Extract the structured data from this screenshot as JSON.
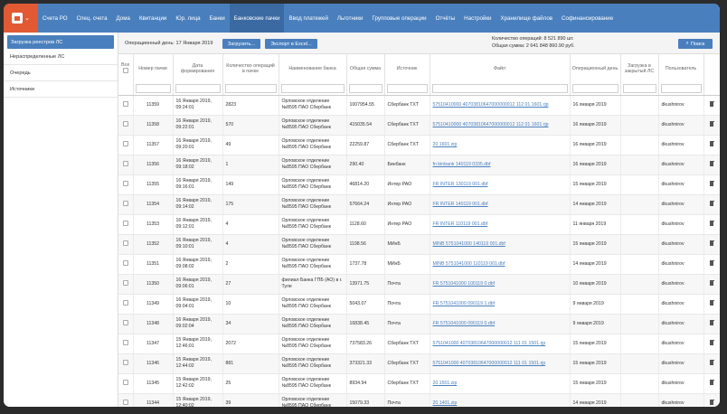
{
  "nav": {
    "items": [
      "Счета РО",
      "Спец. счета",
      "Дома",
      "Квитанции",
      "Юр. лица",
      "Банки",
      "Банковские пачки",
      "Ввод платежей",
      "Льготники",
      "Групповые операции",
      "Отчёты",
      "Настройки",
      "Хранилище файлов",
      "Софинансирование"
    ],
    "active_index": 6
  },
  "sidebar": {
    "items": [
      "Загрузка реестров ЛС",
      "Нераспределенные ЛС",
      "Очередь",
      "Источники"
    ],
    "active_index": 0
  },
  "toolbar": {
    "op_day": "Операционный день: 17 Января 2019",
    "load_label": "Загрузить...",
    "export_label": "Экспорт в Excel...",
    "op_count": "Количество операций: 8 521 890 шт.",
    "op_sum": "Общая сумма: 2 641 848 860.90 руб.",
    "search_label": "Поиск"
  },
  "table": {
    "headers": [
      "Все",
      "Номер пачки",
      "Дата формирования",
      "Количество операций в пачке",
      "Наименование банка",
      "Общая сумма",
      "Источник",
      "Файл",
      "Операционный день",
      "Загрузка в закрытый ЛС",
      "Пользователь"
    ],
    "rows": [
      {
        "num": "11359",
        "date": "16 Января 2019, 09:24:01",
        "count": "2823",
        "bank": "Орловское отделение №8595 ПАО Сбербанк",
        "sum": "1007954.55",
        "src": "Сбербанк ТХТ",
        "file": "57510410000 40703810647000000012 112 01 1601.rjp",
        "day": "16 января 2019",
        "user": "dkushnirov"
      },
      {
        "num": "11358",
        "date": "16 Января 2019, 09:22:01",
        "count": "570",
        "bank": "Орловское отделение №8595 ПАО Сбербанк",
        "sum": "415035.54",
        "src": "Сбербанк ТХТ",
        "file": "57510410000 40703810647000000012 112 01 1601.rjp",
        "day": "16 января 2019",
        "user": "dkushnirov"
      },
      {
        "num": "11357",
        "date": "16 Января 2019, 09:20:01",
        "count": "49",
        "bank": "Орловское отделение №8595 ПАО Сбербанк",
        "sum": "22259.87",
        "src": "Сбербанк ТХТ",
        "file": "20 1601.zip",
        "day": "16 января 2019",
        "user": "dkushnirov"
      },
      {
        "num": "11356",
        "date": "16 Января 2019, 09:18:02",
        "count": "1",
        "bank": "Орловское отделение №8595 ПАО Сбербанк",
        "sum": "290.40",
        "src": "Бинбанк",
        "file": "fn binbank 140119 0335.dbf",
        "day": "16 января 2019",
        "user": "dkushnirov"
      },
      {
        "num": "11355",
        "date": "16 Января 2019, 09:16:01",
        "count": "149",
        "bank": "Орловское отделение №8595 ПАО Сбербанк",
        "sum": "46814.20",
        "src": "Интер РАО",
        "file": "FR INTER 130119 001.dbf",
        "day": "15 января 2019",
        "user": "dkushnirov"
      },
      {
        "num": "11354",
        "date": "16 Января 2019, 09:14:02",
        "count": "175",
        "bank": "Орловское отделение №8595 ПАО Сбербанк",
        "sum": "57664.24",
        "src": "Интер РАО",
        "file": "FR INTER 140119 001.dbf",
        "day": "14 января 2019",
        "user": "dkushnirov"
      },
      {
        "num": "11353",
        "date": "16 Января 2019, 09:12:01",
        "count": "4",
        "bank": "Орловское отделение №8595 ПАО Сбербанк",
        "sum": "1128.60",
        "src": "Интер РАО",
        "file": "FR INTER 110119 001.dbf",
        "day": "11 января 2019",
        "user": "dkushnirov"
      },
      {
        "num": "11352",
        "date": "16 Января 2019, 09:10:01",
        "count": "4",
        "bank": "Орловское отделение №8595 ПАО Сбербанк",
        "sum": "1198.56",
        "src": "МИнБ",
        "file": "MINB 5751041000 140119 001.dbf",
        "day": "15 января 2019",
        "user": "dkushnirov"
      },
      {
        "num": "11351",
        "date": "16 Января 2019, 09:08:02",
        "count": "2",
        "bank": "Орловское отделение №8595 ПАО Сбербанк",
        "sum": "1737.78",
        "src": "МИнБ",
        "file": "MINB 5751041000 110119 001.dbf",
        "day": "14 января 2019",
        "user": "dkushnirov"
      },
      {
        "num": "11350",
        "date": "16 Января 2019, 09:06:01",
        "count": "27",
        "bank": "филиал Банка ГПБ (АО) в г. Туле",
        "sum": "13971.75",
        "src": "Почта",
        "file": "FR 5751041000 100119 0.dbf",
        "day": "10 января 2019",
        "user": "dkushnirov"
      },
      {
        "num": "11349",
        "date": "16 Января 2019, 09:04:01",
        "count": "10",
        "bank": "Орловское отделение №8595 ПАО Сбербанк",
        "sum": "5043.07",
        "src": "Почта",
        "file": "FR 5751041000 090119 1.dbf",
        "day": "9 января 2019",
        "user": "dkushnirov"
      },
      {
        "num": "11348",
        "date": "16 Января 2019, 09:02:04",
        "count": "34",
        "bank": "Орловское отделение №8595 ПАО Сбербанк",
        "sum": "16838.45",
        "src": "Почта",
        "file": "FR 5751041000 090119 0.dbf",
        "day": "9 января 2019",
        "user": "dkushnirov"
      },
      {
        "num": "11347",
        "date": "15 Января 2019, 12:46:01",
        "count": "2072",
        "bank": "Орловское отделение №8595 ПАО Сбербанк",
        "sum": "737583.26",
        "src": "Сбербанк ТХТ",
        "file": "5751041000 40703810647000000012 111 01 1501.rjp",
        "day": "15 января 2019",
        "user": "dkushnirov"
      },
      {
        "num": "11346",
        "date": "15 Января 2019, 12:44:02",
        "count": "881",
        "bank": "Орловское отделение №8595 ПАО Сбербанк",
        "sum": "373321.33",
        "src": "Сбербанк ТХТ",
        "file": "5751041000 40703810647000000012 111 01 1501.rjp",
        "day": "15 января 2019",
        "user": "dkushnirov"
      },
      {
        "num": "11345",
        "date": "15 Января 2019, 12:42:02",
        "count": "25",
        "bank": "Орловское отделение №8595 ПАО Сбербанк",
        "sum": "8934.94",
        "src": "Сбербанк ТХТ",
        "file": "20 1501.zip",
        "day": "15 января 2019",
        "user": "dkushnirov"
      },
      {
        "num": "11344",
        "date": "15 Января 2019, 12:40:02",
        "count": "39",
        "bank": "Орловское отделение №8595 ПАО Сбербанк",
        "sum": "15079.33",
        "src": "Почта",
        "file": "20 1401.zip",
        "day": "14 января 2019",
        "user": "dkushnirov"
      }
    ]
  },
  "icons": {
    "logo": "calculator-icon",
    "dropdown": "chevron-down-icon",
    "search": "search-icon",
    "delete": "trash-icon"
  },
  "colors": {
    "nav_bg": "#4a7fbd",
    "logo_bg": "#e15a33",
    "link": "#4a7fbd"
  }
}
